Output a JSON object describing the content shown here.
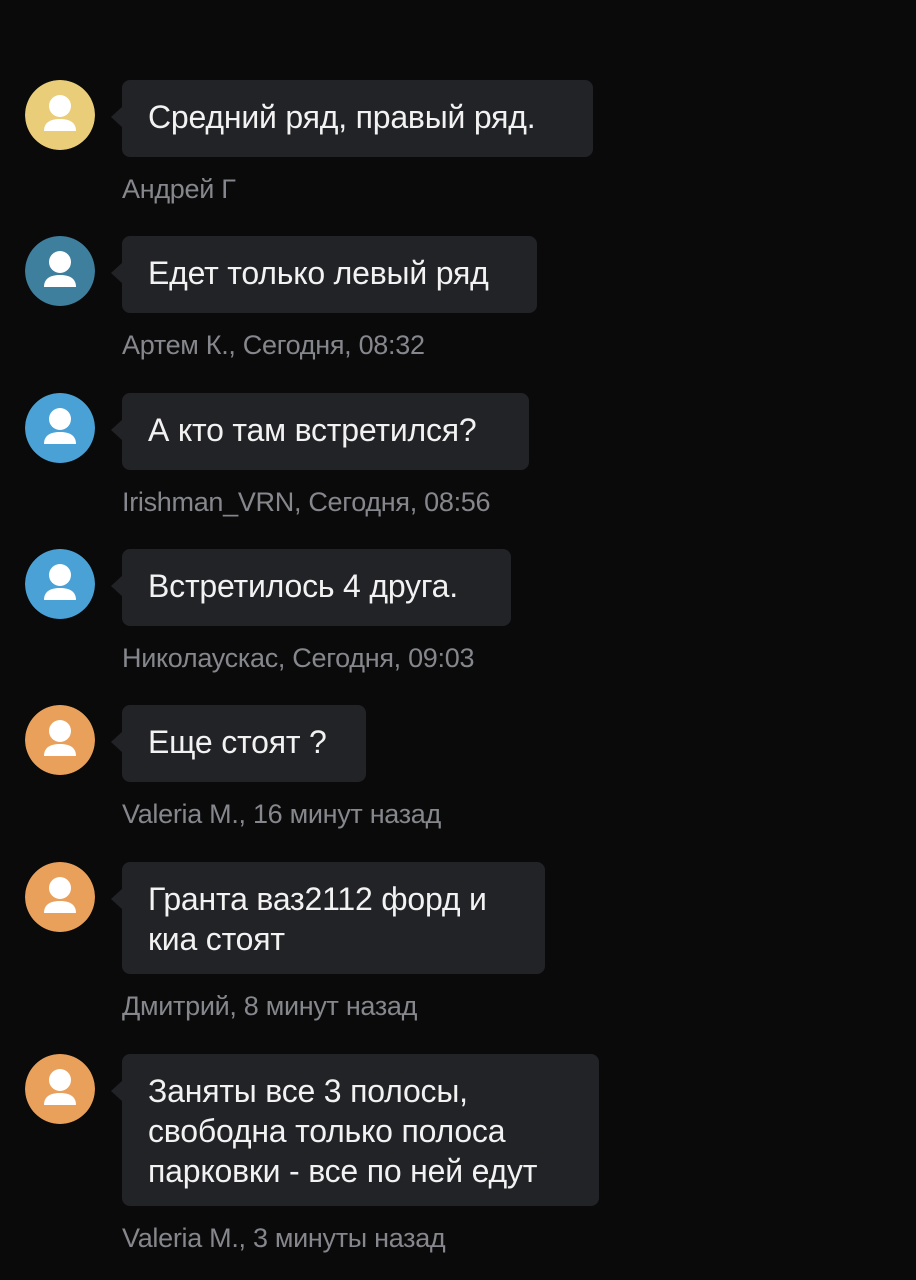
{
  "colors": {
    "background": "#0a0a0b",
    "bubble": "#222327",
    "text": "#f2f2f2",
    "meta": "#85878c"
  },
  "messages": [
    {
      "text": "Средний ряд, правый ряд.",
      "meta": "Андрей Г",
      "avatar_color": "#e9cd79",
      "avatar_icon": "user-silhouette-icon"
    },
    {
      "text": "Едет только левый ряд",
      "meta": "Артем К., Сегодня, 08:32",
      "avatar_color": "#3e7f9e",
      "avatar_icon": "user-silhouette-icon"
    },
    {
      "text": "А кто там встретился?",
      "meta": "Irishman_VRN, Сегодня, 08:56",
      "avatar_color": "#4aa1d6",
      "avatar_icon": "user-silhouette-icon"
    },
    {
      "text": "Встретилось 4 друга.",
      "meta": "Николаускас, Сегодня, 09:03",
      "avatar_color": "#4aa1d6",
      "avatar_icon": "user-silhouette-icon"
    },
    {
      "text": "Еще стоят ?",
      "meta": "Valeria M., 16 минут назад",
      "avatar_color": "#e9a05a",
      "avatar_icon": "user-silhouette-icon"
    },
    {
      "text": "Гранта ваз2112 форд и\nкиа стоят",
      "meta": "Дмитрий, 8 минут назад",
      "avatar_color": "#e9a05a",
      "avatar_icon": "user-silhouette-icon"
    },
    {
      "text": "Заняты все 3 полосы,\nсвободна только полоса\nпарковки - все по ней едут",
      "meta": "Valeria M., 3 минуты назад",
      "avatar_color": "#e9a05a",
      "avatar_icon": "user-silhouette-icon"
    }
  ]
}
